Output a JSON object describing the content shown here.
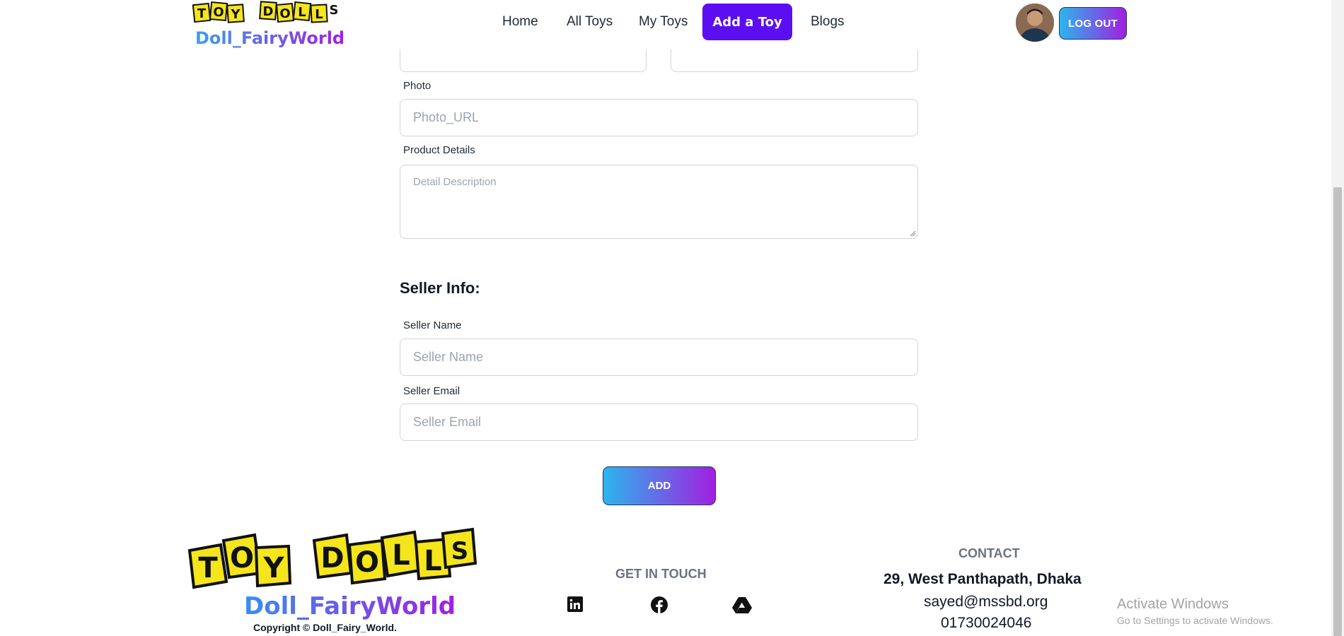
{
  "nav": {
    "logo_text": "TOY DOLLS",
    "brand": "Doll_FairyWorld",
    "links": [
      "Home",
      "All Toys",
      "My Toys",
      "Add a Toy",
      "Blogs"
    ],
    "active": "Add a Toy",
    "logout_label": "LOG OUT"
  },
  "form": {
    "photo_label": "Photo",
    "photo_placeholder": "Photo_URL",
    "details_label": "Product Details",
    "details_placeholder": "Detail Description",
    "seller_section_title": "Seller Info:",
    "seller_name_label": "Seller Name",
    "seller_name_placeholder": "Seller Name",
    "seller_email_label": "Seller Email",
    "seller_email_placeholder": "Seller Email",
    "add_label": "ADD"
  },
  "footer": {
    "logo_text": "TOY DOLLS",
    "brand": "Doll_FairyWorld",
    "copyright": "Copyright © Doll_Fairy_World.",
    "get_in_touch": "GET IN TOUCH",
    "social_icons": [
      "linkedin-icon",
      "facebook-icon",
      "google-drive-icon"
    ],
    "contact_heading": "CONTACT",
    "address": "29, West Panthapath, Dhaka",
    "email": "sayed@mssbd.org",
    "phone": "01730024046"
  },
  "watermark": {
    "line1": "Activate Windows",
    "line2": "Go to Settings to activate Windows."
  },
  "colors": {
    "accent": "#5b0ff0",
    "gradient_start": "#2cb5ee",
    "gradient_end": "#a21fe0"
  }
}
